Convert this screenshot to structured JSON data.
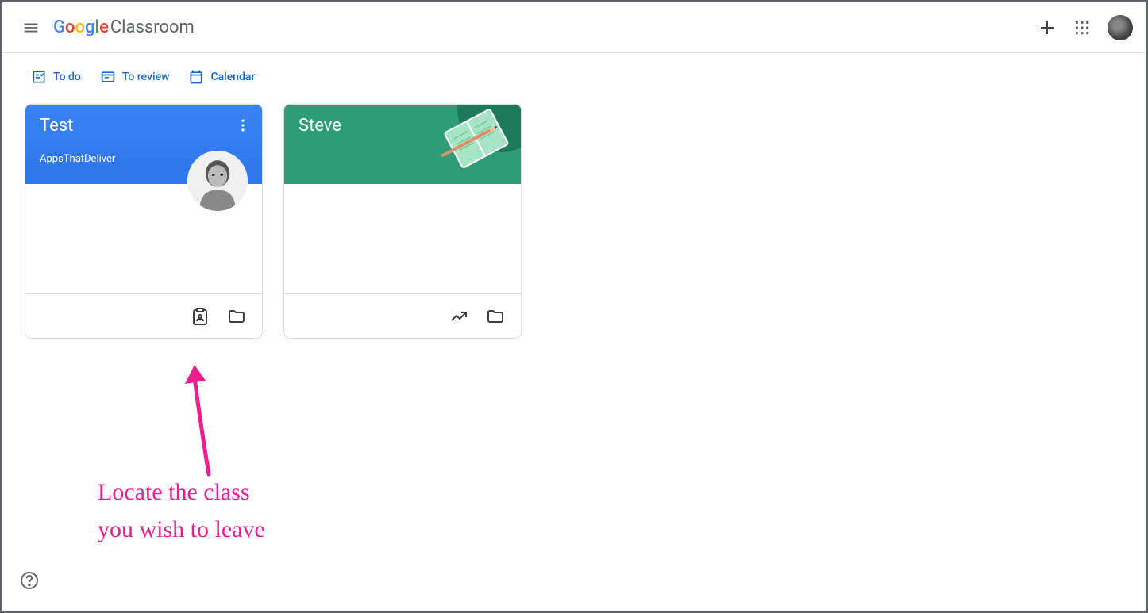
{
  "header": {
    "logo_chars": {
      "g1": "G",
      "g2": "o",
      "g3": "o",
      "g4": "g",
      "g5": "l",
      "g6": "e"
    },
    "product": "Classroom"
  },
  "toolbar": {
    "todo": "To do",
    "toreview": "To review",
    "calendar": "Calendar"
  },
  "cards": [
    {
      "title": "Test",
      "subtitle": "AppsThatDeliver",
      "theme": "blue"
    },
    {
      "title": "Steve",
      "subtitle": "",
      "theme": "green"
    }
  ],
  "annotation": {
    "line1": "Locate the class",
    "line2": "you wish to leave"
  }
}
